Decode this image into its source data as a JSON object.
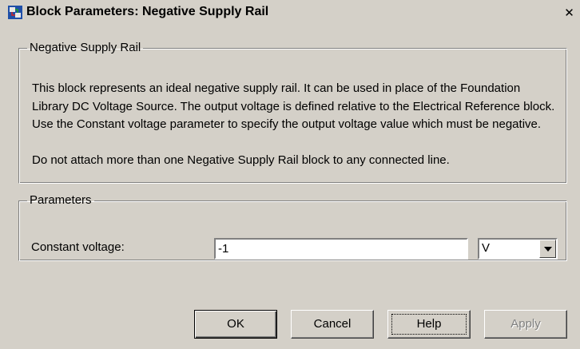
{
  "window": {
    "title": "Block Parameters: Negative Supply Rail",
    "close_glyph": "✕",
    "icon": "simulink-block-icon"
  },
  "description": {
    "legend": "Negative Supply Rail",
    "paragraphs": [
      "This block represents an ideal negative supply rail. It can be used in place of the Foundation Library DC Voltage Source. The output voltage is defined relative to the Electrical Reference block. Use the Constant voltage parameter to specify the output voltage value which must be negative.",
      "Do not attach more than one Negative Supply Rail block to any connected line."
    ]
  },
  "parameters": {
    "legend": "Parameters",
    "constant_voltage": {
      "label": "Constant voltage:",
      "value": "-1",
      "unit": "V"
    }
  },
  "buttons": {
    "ok": "OK",
    "cancel": "Cancel",
    "help": "Help",
    "apply": "Apply"
  }
}
